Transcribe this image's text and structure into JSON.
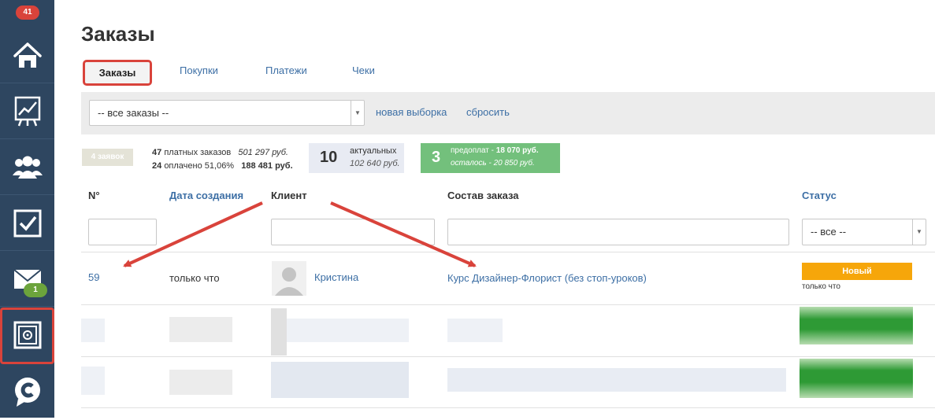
{
  "sidebar": {
    "badge_top": "41",
    "badge_mail": "1",
    "items": [
      {
        "icon": "home-icon"
      },
      {
        "icon": "chart-icon"
      },
      {
        "icon": "users-icon"
      },
      {
        "icon": "checkbox-icon"
      },
      {
        "icon": "mail-icon"
      },
      {
        "icon": "safe-icon"
      },
      {
        "icon": "chat-logo-icon"
      }
    ]
  },
  "page": {
    "title": "Заказы",
    "tabs": [
      "Заказы",
      "Покупки",
      "Платежи",
      "Чеки"
    ],
    "active_tab": "Заказы"
  },
  "filter": {
    "select_value": "-- все заказы --",
    "new_selection": "новая выборка",
    "reset": "сбросить"
  },
  "stats": {
    "count_tag": "4 заявок",
    "paid_count": "47",
    "paid_label": "платных заказов",
    "paid_sum": "501 297 руб.",
    "paid_done_count": "24",
    "paid_done_label": "оплачено 51,06%",
    "paid_done_sum": "188 481 руб.",
    "actual_num": "10",
    "actual_label": "актуальных",
    "actual_sum": "102 640 руб.",
    "prepay_num": "3",
    "prepay_label": "предоплат -",
    "prepay_sum": "18 070 руб.",
    "remaining": "осталось - 20 850 руб."
  },
  "table": {
    "headers": [
      "N°",
      "Дата создания",
      "Клиент",
      "Состав заказа",
      "Статус"
    ],
    "status_filter": "-- все --",
    "rows": [
      {
        "number": "59",
        "date": "только что",
        "client": "Кристина",
        "order": "Курс Дизайнер-Флорист (без стоп-уроков)",
        "status": "Новый",
        "status_time": "только что"
      }
    ]
  },
  "colors": {
    "sidebar_bg": "#2e4660",
    "link": "#3d6fa5",
    "status_new": "#f6a60a",
    "prepay_box": "#73c07c",
    "annotation": "#d9433b"
  }
}
